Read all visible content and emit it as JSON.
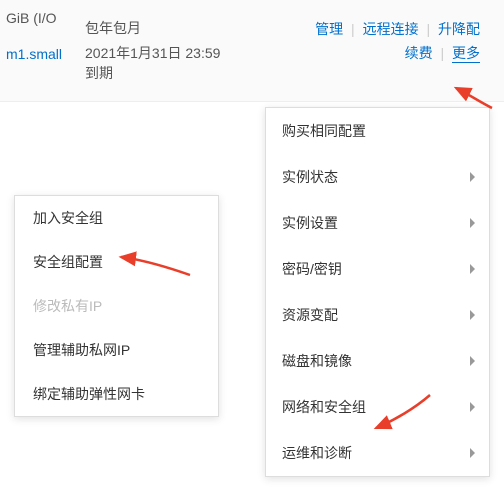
{
  "row": {
    "spec_line": "GiB (I/O",
    "instance_type": "m1.small",
    "billing_type": "包年包月",
    "expire": "2021年1月31日 23:59 到期"
  },
  "actions": {
    "manage": "管理",
    "remote": "远程连接",
    "upgrade": "升降配",
    "renew": "续费",
    "more": "更多"
  },
  "main_menu": [
    {
      "label": "购买相同配置",
      "has_sub": false
    },
    {
      "label": "实例状态",
      "has_sub": true
    },
    {
      "label": "实例设置",
      "has_sub": true
    },
    {
      "label": "密码/密钥",
      "has_sub": true
    },
    {
      "label": "资源变配",
      "has_sub": true
    },
    {
      "label": "磁盘和镜像",
      "has_sub": true
    },
    {
      "label": "网络和安全组",
      "has_sub": true
    },
    {
      "label": "运维和诊断",
      "has_sub": true
    }
  ],
  "sub_menu": [
    {
      "label": "加入安全组",
      "disabled": false
    },
    {
      "label": "安全组配置",
      "disabled": false
    },
    {
      "label": "修改私有IP",
      "disabled": true
    },
    {
      "label": "管理辅助私网IP",
      "disabled": false
    },
    {
      "label": "绑定辅助弹性网卡",
      "disabled": false
    }
  ]
}
